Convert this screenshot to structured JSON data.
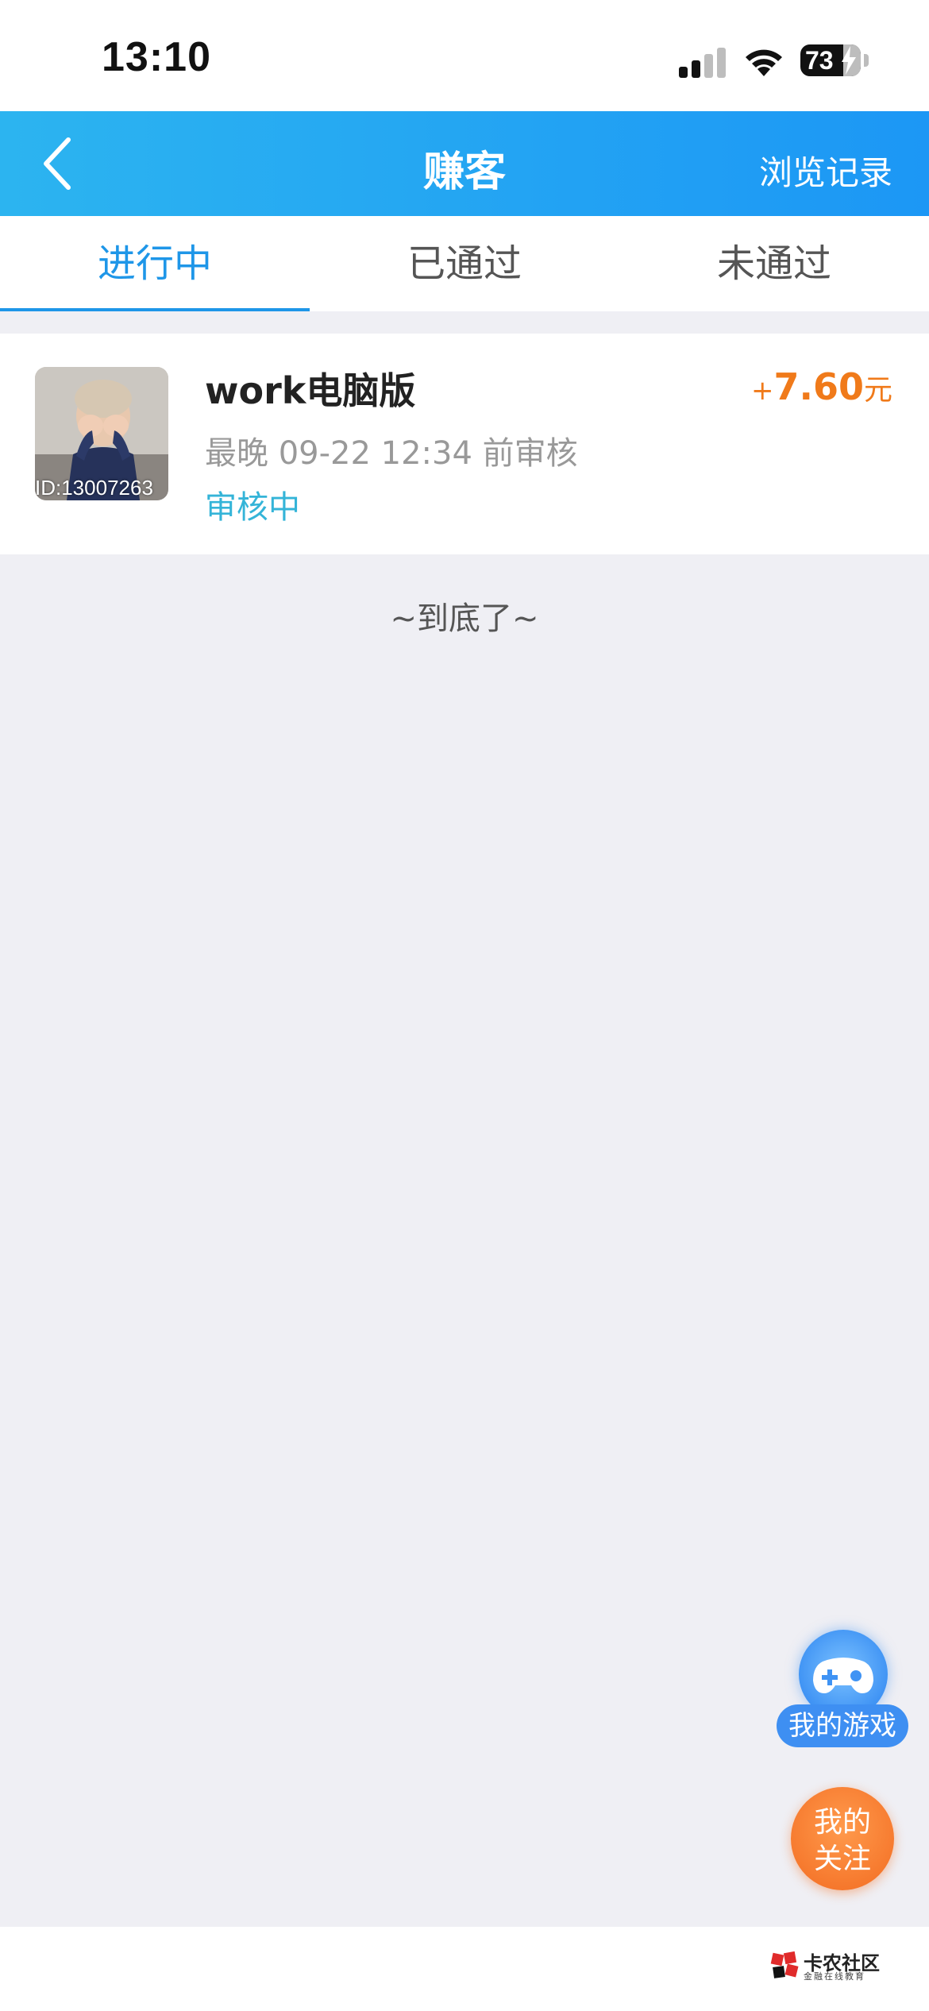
{
  "status_bar": {
    "time": "13:10",
    "battery": "73",
    "signal_icon": "cellular-signal-icon",
    "wifi_icon": "wifi-icon",
    "battery_icon": "battery-charging-icon"
  },
  "nav": {
    "title": "赚客",
    "history_label": "浏览记录",
    "back_icon": "chevron-left-icon"
  },
  "tabs": [
    {
      "label": "进行中",
      "active": true
    },
    {
      "label": "已通过",
      "active": false
    },
    {
      "label": "未通过",
      "active": false
    }
  ],
  "tasks": [
    {
      "title": "work电脑版",
      "deadline": "最晚 09-22 12:34 前审核",
      "status": "审核中",
      "thumb_id": "ID:13007263",
      "reward_plus": "+",
      "reward_amount": "7.60",
      "reward_unit": "元"
    }
  ],
  "list_end": "~到底了~",
  "fab": {
    "games_label": "我的游戏",
    "games_icon": "gamepad-icon",
    "follow_line1": "我的",
    "follow_line2": "关注"
  },
  "watermark": {
    "name": "卡农社区",
    "sub": "金融在线教育"
  },
  "colors": {
    "accent": "#1e96e8",
    "nav_gradient_start": "#2cb4f0",
    "nav_gradient_end": "#1c97f5",
    "reward": "#f07a1a",
    "status_text": "#34b4d8",
    "page_bg": "#efeff4"
  }
}
